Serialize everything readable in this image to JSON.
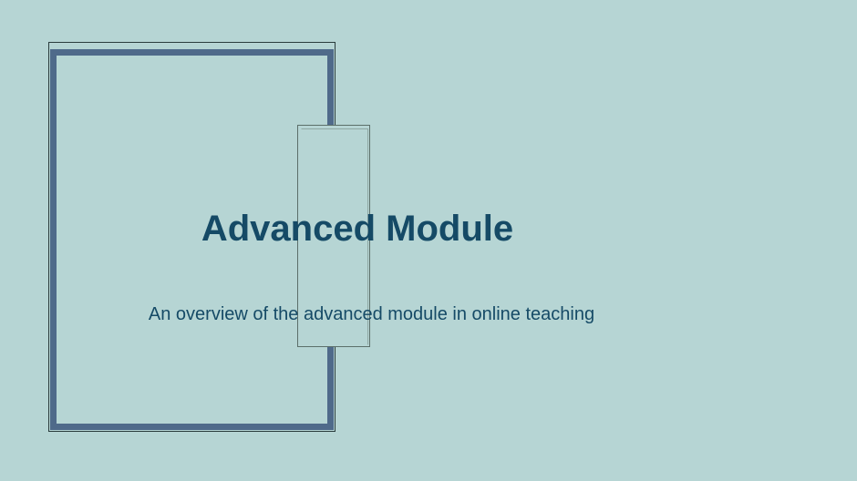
{
  "slide": {
    "title": "Advanced Module",
    "subtitle": "An overview of the advanced module in online teaching"
  },
  "colors": {
    "background": "#b6d5d4",
    "frame": "#4f6a8a",
    "text": "#154a66"
  }
}
